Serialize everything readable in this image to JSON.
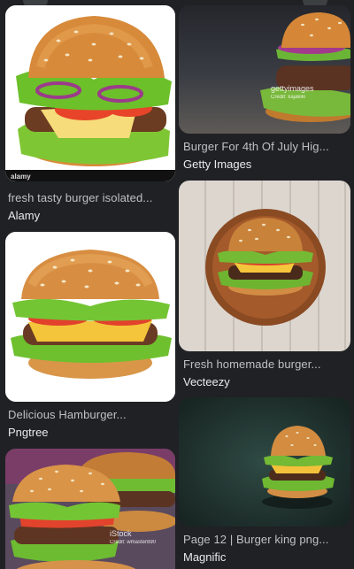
{
  "results": [
    {
      "title": "fresh tasty burger isolated...",
      "source": "Alamy",
      "watermark": "alamy"
    },
    {
      "title": "Burger For 4th Of July Hig...",
      "source": "Getty Images",
      "watermark": "gettyimages",
      "credit": "Credit: kajakiki"
    },
    {
      "title": "Delicious Hamburger...",
      "source": "Pngtree"
    },
    {
      "title": "Fresh homemade burger...",
      "source": "Vecteezy"
    },
    {
      "title": "",
      "source": "",
      "watermark": "iStock",
      "credit": "Credit: wmaster890"
    },
    {
      "title": "Page 12 | Burger king png...",
      "source": "Magnific"
    }
  ]
}
